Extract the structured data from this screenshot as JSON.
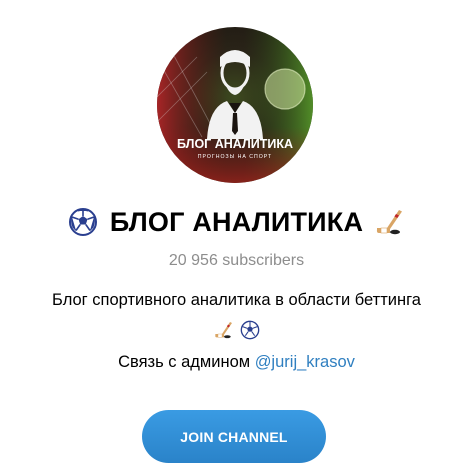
{
  "channel": {
    "avatar": {
      "banner_title": "БЛОГ АНАЛИТИКА",
      "banner_subtitle": "ПРОГНОЗЫ НА СПОРТ"
    },
    "title": "БЛОГ АНАЛИТИКА",
    "title_icons": [
      "soccer-ball-icon",
      "hockey-stick-icon"
    ],
    "subscribers": "20 956 subscribers",
    "description": {
      "line1": "Блог спортивного аналитика в области беттинга",
      "icons": [
        "hockey-stick-icon",
        "soccer-ball-icon"
      ],
      "contact_prefix": "Связь с админом ",
      "contact_link": "@jurij_krasov"
    },
    "join_label": "JOIN CHANNEL"
  },
  "colors": {
    "accent": "#2a83c9",
    "link": "#2f7fc0",
    "muted_text": "#8d8d8d"
  }
}
